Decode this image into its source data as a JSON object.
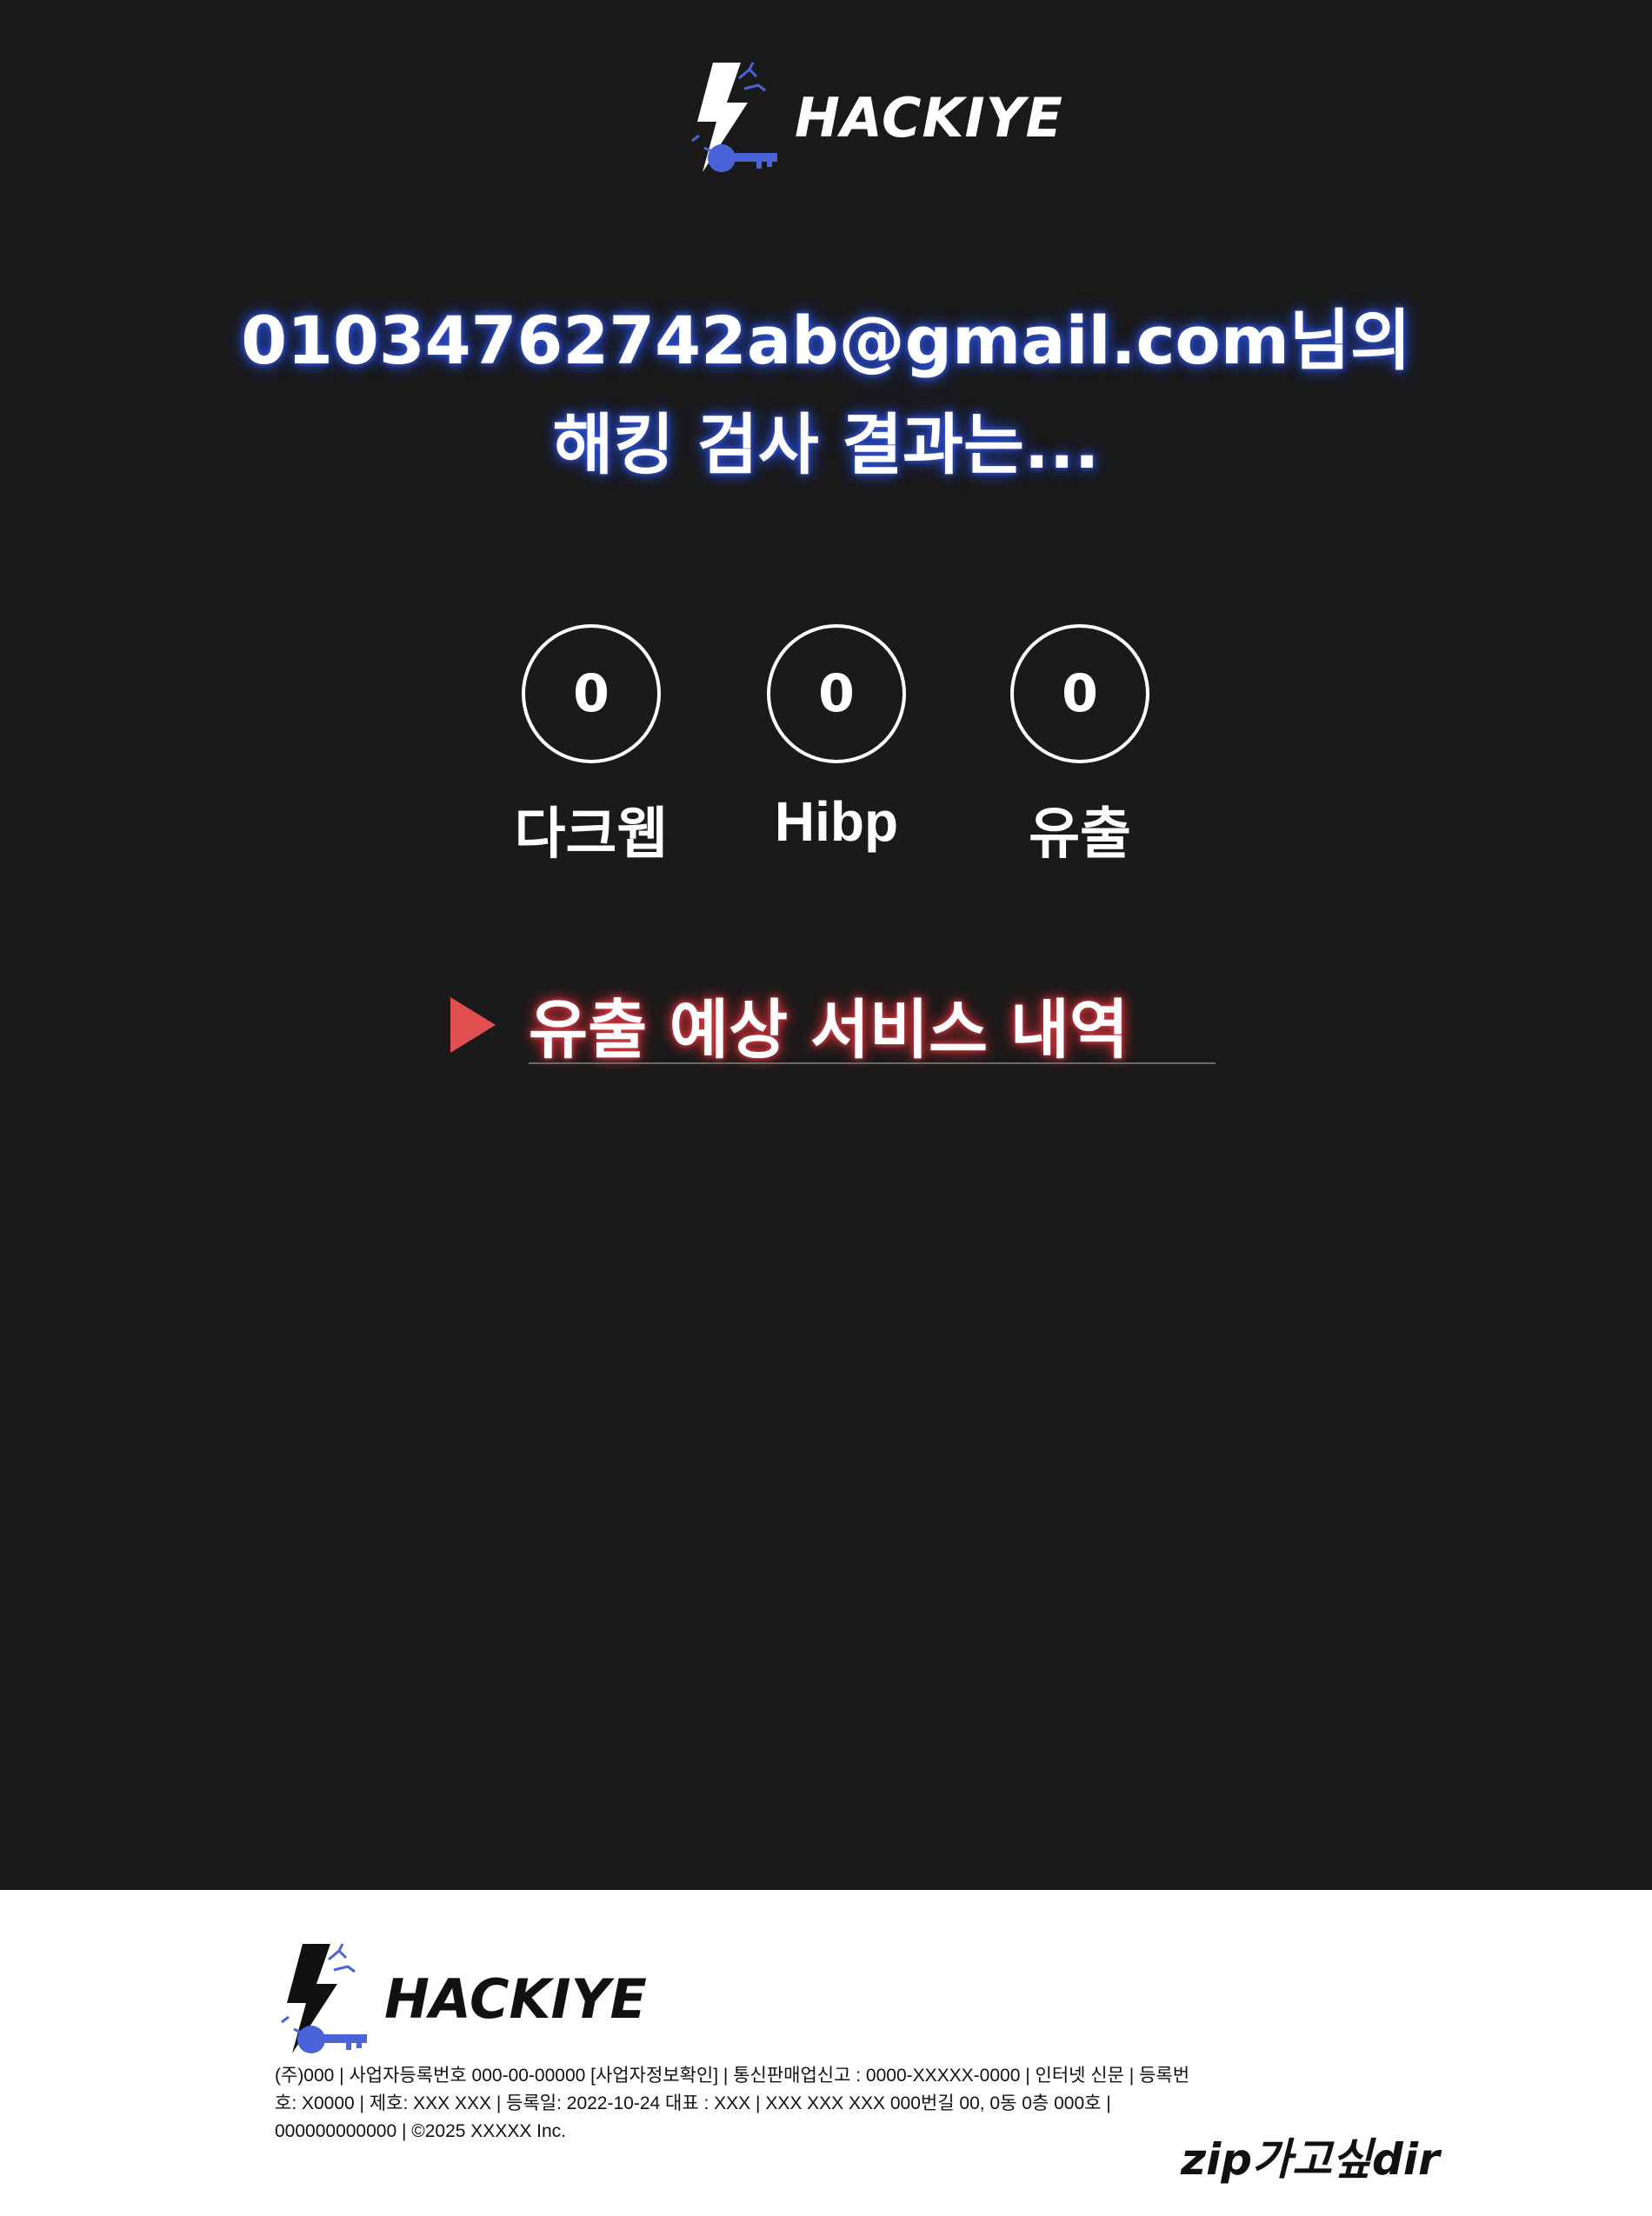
{
  "brand": {
    "name": "HACKIYE",
    "colors": {
      "bolt": "#ffffff",
      "key": "#4a63d8",
      "accent_blue": "#3a5bd9",
      "accent_red": "#e05050"
    }
  },
  "result": {
    "email_line": "01034762742ab@gmail.com님의",
    "subtitle_line": "해킹 검사 결과는..."
  },
  "stats": [
    {
      "value": "0",
      "label": "다크웹"
    },
    {
      "value": "0",
      "label": "Hibp"
    },
    {
      "value": "0",
      "label": "유출"
    }
  ],
  "section": {
    "title": "유출 예상 서비스 내역"
  },
  "footer": {
    "brand_name": "HACKIYE",
    "company_info": "(주)000 | 사업자등록번호 000-00-00000 [사업자정보확인] | 통신판매업신고 : 0000-XXXXX-0000 | 인터넷 신문 | 등록번호: X0000 | 제호: XXX XXX | 등록일: 2022-10-24 대표 : XXX | XXX XXX XXX 000번길 00, 0동 0층 000호 | 000000000000 | ©2025 XXXXX Inc.",
    "tagline": "zip가고싶dir"
  }
}
